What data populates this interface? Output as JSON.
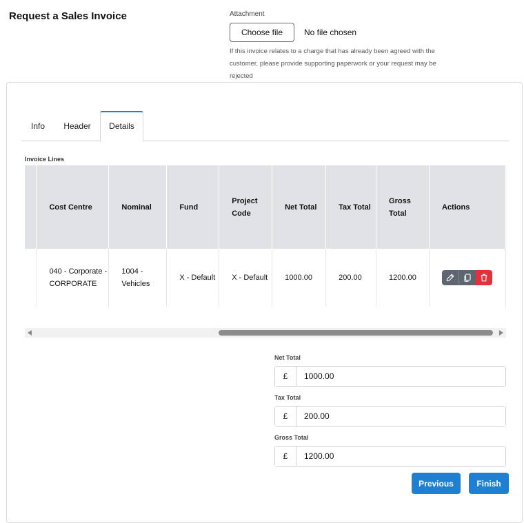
{
  "page": {
    "title": "Request a Sales Invoice"
  },
  "attachment": {
    "label": "Attachment",
    "button_label": "Choose file",
    "status": "No file chosen",
    "help_text": "If this invoice relates to a charge that has already been agreed with the customer, please provide supporting paperwork or your request may be rejected"
  },
  "tabs": [
    {
      "label": "Info",
      "active": false
    },
    {
      "label": "Header",
      "active": false
    },
    {
      "label": "Details",
      "active": true
    }
  ],
  "invoice_lines": {
    "label": "Invoice Lines",
    "columns": {
      "cost_centre": "Cost Centre",
      "nominal": "Nominal",
      "fund": "Fund",
      "project_code": "Project Code",
      "net_total": "Net Total",
      "tax_total": "Tax Total",
      "gross_total": "Gross Total",
      "actions": "Actions"
    },
    "rows": [
      {
        "cost_centre": "040 - Corporate - CORPORATE",
        "nominal": "1004 - Vehicles",
        "fund": "X - Default",
        "project_code": "X - Default",
        "net_total": "1000.00",
        "tax_total": "200.00",
        "gross_total": "1200.00"
      }
    ],
    "action_icons": [
      "pencil-icon",
      "copy-icon",
      "trash-icon"
    ]
  },
  "totals": {
    "currency_symbol": "£",
    "net": {
      "label": "Net Total",
      "value": "1000.00"
    },
    "tax": {
      "label": "Tax Total",
      "value": "200.00"
    },
    "gross": {
      "label": "Gross Total",
      "value": "1200.00"
    }
  },
  "buttons": {
    "previous": "Previous",
    "finish": "Finish"
  },
  "colors": {
    "primary": "#1f7fd1",
    "danger": "#e0313c",
    "action_grey": "#5f6672",
    "header_bg": "#e1e2e6"
  }
}
